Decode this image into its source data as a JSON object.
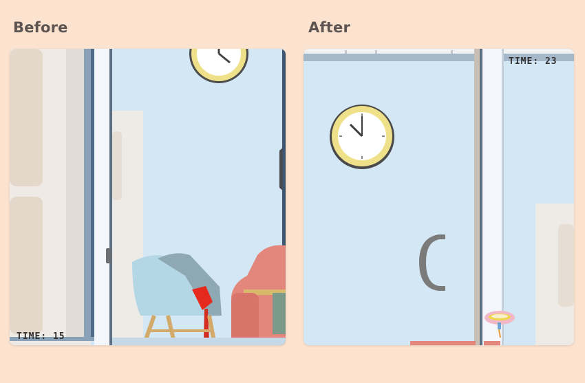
{
  "comparison": {
    "before": {
      "label": "Before",
      "timer": "TIME: 15"
    },
    "after": {
      "label": "After",
      "timer": "TIME: 23"
    }
  },
  "colors": {
    "background": "#fce3cf",
    "wall": "#d3e7f4",
    "clock_rim": "#efe08a",
    "chair": "#b4d7e6",
    "sofa": "#e3867b",
    "door_frame": "#f3f6fa"
  }
}
